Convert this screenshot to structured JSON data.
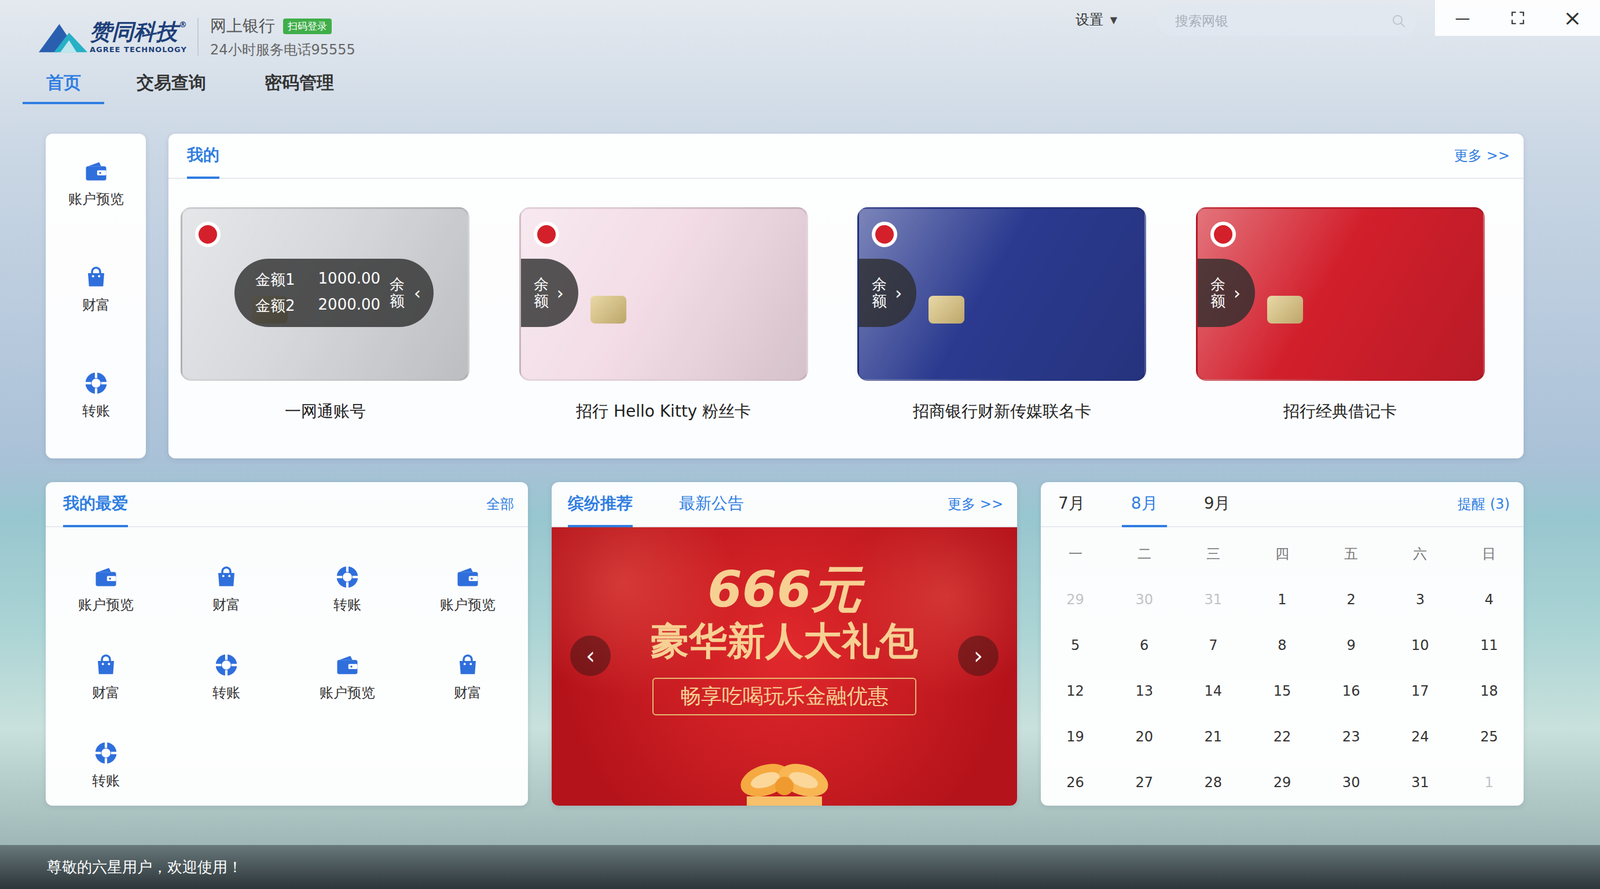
{
  "app": {
    "logo_text": "赞同科技",
    "logo_mark": "®",
    "logo_subtitle": "AGREE TECHNOLOGY",
    "title": "网上银行",
    "badge": "扫码登录",
    "hotline": "24小时服务电话95555"
  },
  "header": {
    "settings": "设置",
    "settings_arrow": "▼",
    "search": {
      "placeholder": "搜索网银"
    },
    "window_controls": {
      "minimize": "—",
      "close": "×"
    }
  },
  "nav_tabs": [
    {
      "label": "首页",
      "selected": true
    },
    {
      "label": "交易查询",
      "selected": false
    },
    {
      "label": "密码管理",
      "selected": false
    }
  ],
  "sidebar": {
    "items": [
      {
        "label": "账户预览",
        "kind": "wallet"
      },
      {
        "label": "财富",
        "kind": "bag"
      },
      {
        "label": "转账",
        "kind": "ring"
      }
    ]
  },
  "my_cards": {
    "tabs": [
      {
        "label": "我的",
        "selected": true
      }
    ],
    "more": "更多 >>",
    "cards": [
      {
        "name": "一网通账号",
        "color": "#d6d8dc",
        "expanded": true,
        "toggle_label": "余额",
        "arrow": "‹",
        "balances": [
          {
            "label": "金额1",
            "amount": "1000.00"
          },
          {
            "label": "金额2",
            "amount": "2000.00"
          }
        ]
      },
      {
        "name": "招行 Hello Kitty 粉丝卡",
        "color": "#f3dce6",
        "expanded": false,
        "toggle_label": "余额",
        "arrow": "›",
        "balances": []
      },
      {
        "name": "招商银行财新传媒联名卡",
        "color": "#2b3a8f",
        "expanded": false,
        "toggle_label": "余额",
        "arrow": "›",
        "balances": []
      },
      {
        "name": "招行经典借记卡",
        "color": "#d21f2c",
        "expanded": false,
        "toggle_label": "余额",
        "arrow": "›",
        "balances": []
      }
    ]
  },
  "favorites": {
    "tabs": [
      {
        "label": "我的最爱",
        "selected": true
      }
    ],
    "all": "全部",
    "items": [
      {
        "label": "账户预览",
        "kind": "wallet"
      },
      {
        "label": "财富",
        "kind": "bag"
      },
      {
        "label": "转账",
        "kind": "ring"
      },
      {
        "label": "账户预览",
        "kind": "wallet"
      },
      {
        "label": "财富",
        "kind": "bag"
      },
      {
        "label": "转账",
        "kind": "ring"
      },
      {
        "label": "账户预览",
        "kind": "wallet"
      },
      {
        "label": "财富",
        "kind": "bag"
      },
      {
        "label": "转账",
        "kind": "ring"
      }
    ]
  },
  "promotions": {
    "tabs": [
      {
        "label": "缤纷推荐",
        "selected": true
      },
      {
        "label": "最新公告",
        "selected": false
      }
    ],
    "more": "更多 >>",
    "banner": {
      "headline": "666元",
      "title": "豪华新人大礼包",
      "subtitle": "畅享吃喝玩乐金融优惠",
      "prev": "‹",
      "next": "›"
    }
  },
  "calendar": {
    "months": [
      {
        "label": "7月",
        "selected": false
      },
      {
        "label": "8月",
        "selected": true
      },
      {
        "label": "9月",
        "selected": false
      }
    ],
    "reminders": "提醒 (3)",
    "weekdays": [
      "一",
      "二",
      "三",
      "四",
      "五",
      "六",
      "日"
    ],
    "days": [
      {
        "label": "29",
        "outside": true
      },
      {
        "label": "30",
        "outside": true
      },
      {
        "label": "31",
        "outside": true
      },
      {
        "label": "1",
        "outside": false
      },
      {
        "label": "2",
        "outside": false
      },
      {
        "label": "3",
        "outside": false
      },
      {
        "label": "4",
        "outside": false
      },
      {
        "label": "5",
        "outside": false
      },
      {
        "label": "6",
        "outside": false
      },
      {
        "label": "7",
        "outside": false
      },
      {
        "label": "8",
        "outside": false
      },
      {
        "label": "9",
        "outside": false
      },
      {
        "label": "10",
        "outside": false
      },
      {
        "label": "11",
        "outside": false
      },
      {
        "label": "12",
        "outside": false
      },
      {
        "label": "13",
        "outside": false
      },
      {
        "label": "14",
        "outside": false
      },
      {
        "label": "15",
        "outside": false
      },
      {
        "label": "16",
        "outside": false
      },
      {
        "label": "17",
        "outside": false
      },
      {
        "label": "18",
        "outside": false
      },
      {
        "label": "19",
        "outside": false
      },
      {
        "label": "20",
        "outside": false
      },
      {
        "label": "21",
        "outside": false
      },
      {
        "label": "22",
        "outside": false
      },
      {
        "label": "23",
        "outside": false
      },
      {
        "label": "24",
        "outside": false
      },
      {
        "label": "25",
        "outside": false
      },
      {
        "label": "26",
        "outside": false
      },
      {
        "label": "27",
        "outside": false
      },
      {
        "label": "28",
        "outside": false
      },
      {
        "label": "29",
        "outside": false
      },
      {
        "label": "30",
        "outside": false
      },
      {
        "label": "31",
        "outside": false
      },
      {
        "label": "1",
        "outside": true
      }
    ]
  },
  "status_bar": {
    "text": "尊敬的六星用户，欢迎使用！"
  }
}
